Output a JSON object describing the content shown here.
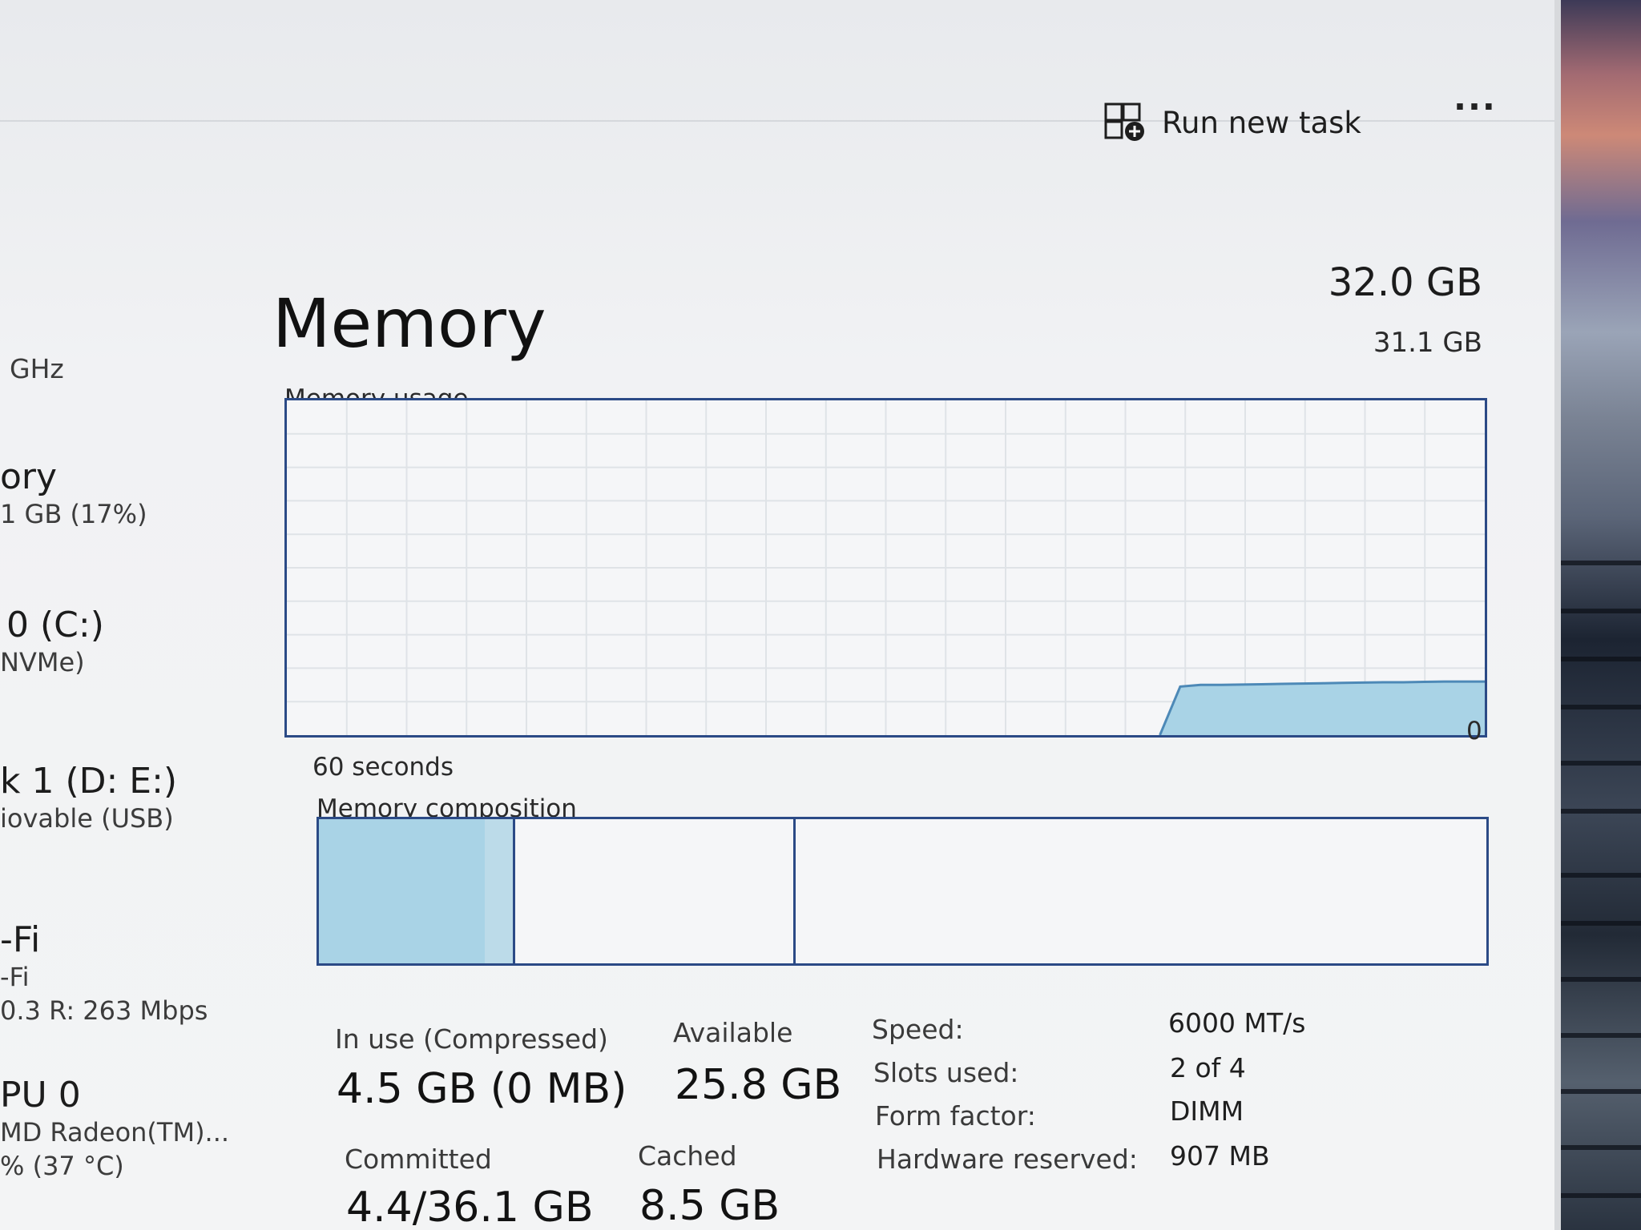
{
  "toolbar": {
    "run_new_task_label": "Run new task",
    "more_label": "..."
  },
  "sidebar": {
    "items": [
      {
        "title": "",
        "sub": "GHz"
      },
      {
        "title": "ory",
        "sub": "1 GB (17%)"
      },
      {
        "title": "0 (C:)",
        "sub": "NVMe)"
      },
      {
        "title": "k 1 (D: E:)",
        "sub": "iovable (USB)"
      },
      {
        "title": "-Fi",
        "sub": "-Fi",
        "sub2": "0.3 R: 263 Mbps"
      },
      {
        "title": "PU 0",
        "sub": "MD Radeon(TM)...",
        "sub2": "% (37 °C)"
      }
    ]
  },
  "page": {
    "title": "Memory",
    "total": "32.0 GB"
  },
  "usage_graph": {
    "label": "Memory usage",
    "max_label": "31.1 GB",
    "min_label": "0",
    "time_label": "60 seconds",
    "history_fraction": [
      0,
      0,
      0,
      0,
      0,
      0,
      0,
      0,
      0,
      0,
      0,
      0,
      0,
      0,
      0,
      0,
      0,
      0,
      0,
      0,
      0,
      0,
      0,
      0,
      0,
      0,
      0,
      0,
      0,
      0,
      0,
      0,
      0,
      0,
      0,
      0,
      0,
      0,
      0,
      0,
      0,
      0,
      0,
      0,
      0.145,
      0.15,
      0.15,
      0.151,
      0.152,
      0.153,
      0.154,
      0.155,
      0.156,
      0.157,
      0.158,
      0.158,
      0.159,
      0.16,
      0.16,
      0.16
    ]
  },
  "composition": {
    "label": "Memory composition",
    "segments": [
      {
        "name": "in-use",
        "fraction": 0.142
      },
      {
        "name": "modified",
        "fraction": 0.024
      },
      {
        "name": "standby",
        "fraction": 0.24
      },
      {
        "name": "free",
        "fraction": 0.594
      }
    ]
  },
  "stats": {
    "in_use_label": "In use (Compressed)",
    "in_use_value": "4.5 GB (0 MB)",
    "available_label": "Available",
    "available_value": "25.8 GB",
    "committed_label": "Committed",
    "committed_value": "4.4/36.1 GB",
    "cached_label": "Cached",
    "cached_value": "8.5 GB"
  },
  "specs": {
    "speed_label": "Speed:",
    "speed_value": "6000 MT/s",
    "slots_label": "Slots used:",
    "slots_value": "2 of 4",
    "form_label": "Form factor:",
    "form_value": "DIMM",
    "reserved_label": "Hardware reserved:",
    "reserved_value": "907 MB"
  },
  "colors": {
    "accent_border": "#2b4a86",
    "fill": "#a9d3e6",
    "fill_mid": "#bcdbe9",
    "fill_line": "#4d89b7",
    "grid": "#dfe3e7"
  }
}
